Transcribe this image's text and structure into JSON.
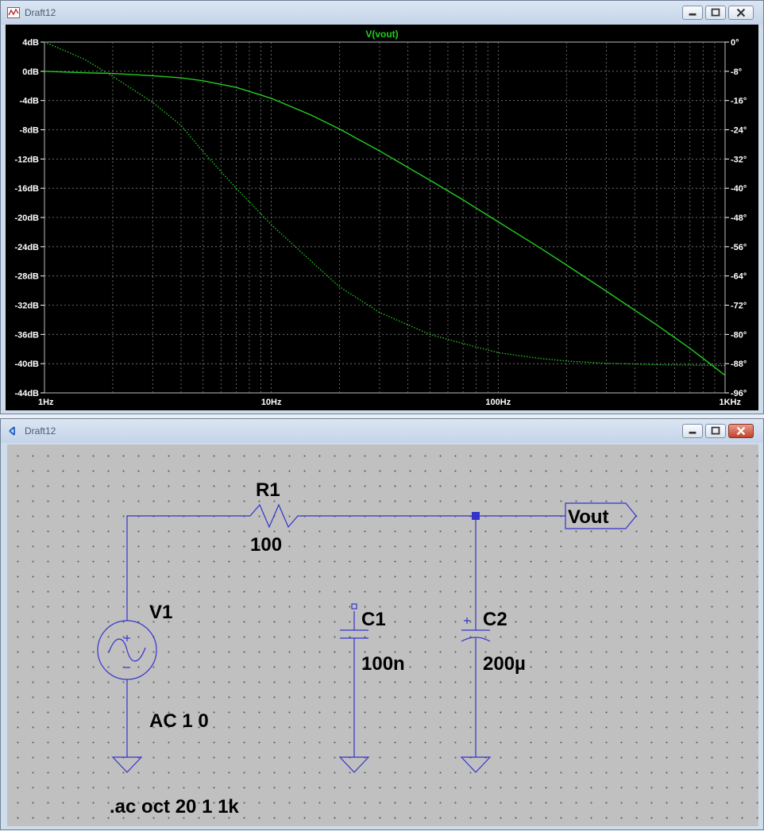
{
  "plot_window": {
    "title": "Draft12",
    "trace_label": "V(vout)"
  },
  "schematic_window": {
    "title": "Draft12"
  },
  "colors": {
    "trace": "#22cc22",
    "plot_bg": "#000000",
    "wire": "#3333cc",
    "schematic_bg": "#c0c0c0"
  },
  "chart_data": {
    "type": "line",
    "title": "V(vout)",
    "x_scale": "log",
    "xlim": [
      1,
      1000
    ],
    "x_ticks": [
      "1Hz",
      "10Hz",
      "100Hz",
      "1KHz"
    ],
    "ylim_left": [
      -44,
      4
    ],
    "y_ticks_left": [
      "4dB",
      "0dB",
      "-4dB",
      "-8dB",
      "-12dB",
      "-16dB",
      "-20dB",
      "-24dB",
      "-28dB",
      "-32dB",
      "-36dB",
      "-40dB",
      "-44dB"
    ],
    "ylim_right": [
      -96,
      0
    ],
    "y_ticks_right": [
      "0°",
      "-8°",
      "-16°",
      "-24°",
      "-32°",
      "-40°",
      "-48°",
      "-56°",
      "-64°",
      "-72°",
      "-80°",
      "-88°",
      "-96°"
    ],
    "grid": true,
    "series": [
      {
        "axis": "left",
        "style": "solid",
        "x": [
          1,
          1.5,
          2,
          3,
          4,
          5,
          7,
          10,
          15,
          20,
          30,
          50,
          70,
          100,
          150,
          200,
          300,
          500,
          700,
          1000
        ],
        "y": [
          0,
          -0.2,
          -0.3,
          -0.6,
          -0.9,
          -1.3,
          -2.2,
          -3.7,
          -6.0,
          -7.9,
          -10.9,
          -14.9,
          -17.6,
          -20.6,
          -24.0,
          -26.5,
          -30.1,
          -34.7,
          -37.9,
          -41.6
        ]
      },
      {
        "axis": "right",
        "style": "dotted",
        "x": [
          1,
          1.5,
          2,
          3,
          4,
          5,
          7,
          10,
          15,
          20,
          30,
          50,
          70,
          100,
          150,
          200,
          300,
          500,
          700,
          1000
        ],
        "y": [
          0,
          -4.7,
          -9.4,
          -16.5,
          -22.8,
          -30.0,
          -40.0,
          -50.0,
          -60.0,
          -67.0,
          -74.0,
          -80.0,
          -82.5,
          -85.0,
          -86.5,
          -87.3,
          -87.9,
          -88.3,
          -88.4,
          -88.5
        ]
      }
    ]
  },
  "schematic": {
    "r1": {
      "name": "R1",
      "value": "100"
    },
    "v1": {
      "name": "V1",
      "value": "AC 1 0"
    },
    "c1": {
      "name": "C1",
      "value": "100n"
    },
    "c2": {
      "name": "C2",
      "value": "200µ"
    },
    "net_label": "Vout",
    "directive": ".ac oct 20 1 1k"
  }
}
